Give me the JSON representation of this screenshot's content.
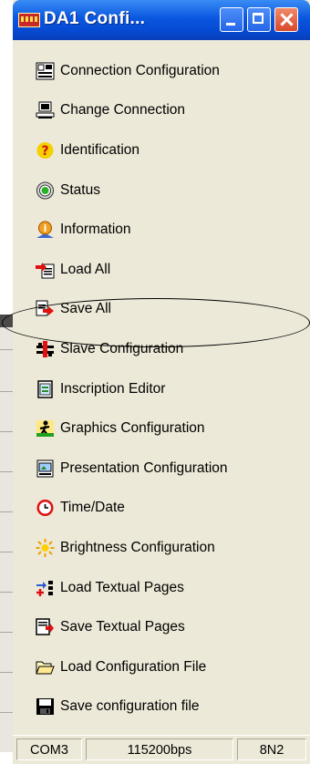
{
  "window": {
    "title": "DA1 Confi..."
  },
  "menu": {
    "items": [
      {
        "label": "Connection Configuration",
        "icon": "connection-config-icon"
      },
      {
        "label": "Change Connection",
        "icon": "change-connection-icon"
      },
      {
        "label": "Identification",
        "icon": "question-icon"
      },
      {
        "label": "Status",
        "icon": "status-icon"
      },
      {
        "label": "Information",
        "icon": "information-icon"
      },
      {
        "label": "Load All",
        "icon": "load-all-icon"
      },
      {
        "label": "Save All",
        "icon": "save-all-icon"
      },
      {
        "label": "Slave Configuration",
        "icon": "slave-config-icon"
      },
      {
        "label": "Inscription Editor",
        "icon": "inscription-editor-icon"
      },
      {
        "label": "Graphics Configuration",
        "icon": "graphics-icon"
      },
      {
        "label": "Presentation Configuration",
        "icon": "presentation-icon"
      },
      {
        "label": "Time/Date",
        "icon": "clock-icon"
      },
      {
        "label": "Brightness Configuration",
        "icon": "brightness-icon"
      },
      {
        "label": "Load Textual Pages",
        "icon": "load-text-icon"
      },
      {
        "label": "Save Textual Pages",
        "icon": "save-text-icon"
      },
      {
        "label": "Load Configuration File",
        "icon": "open-folder-icon"
      },
      {
        "label": "Save configuration file",
        "icon": "floppy-disk-icon"
      }
    ]
  },
  "statusbar": {
    "port": "COM3",
    "baud": "115200bps",
    "format": "8N2"
  }
}
